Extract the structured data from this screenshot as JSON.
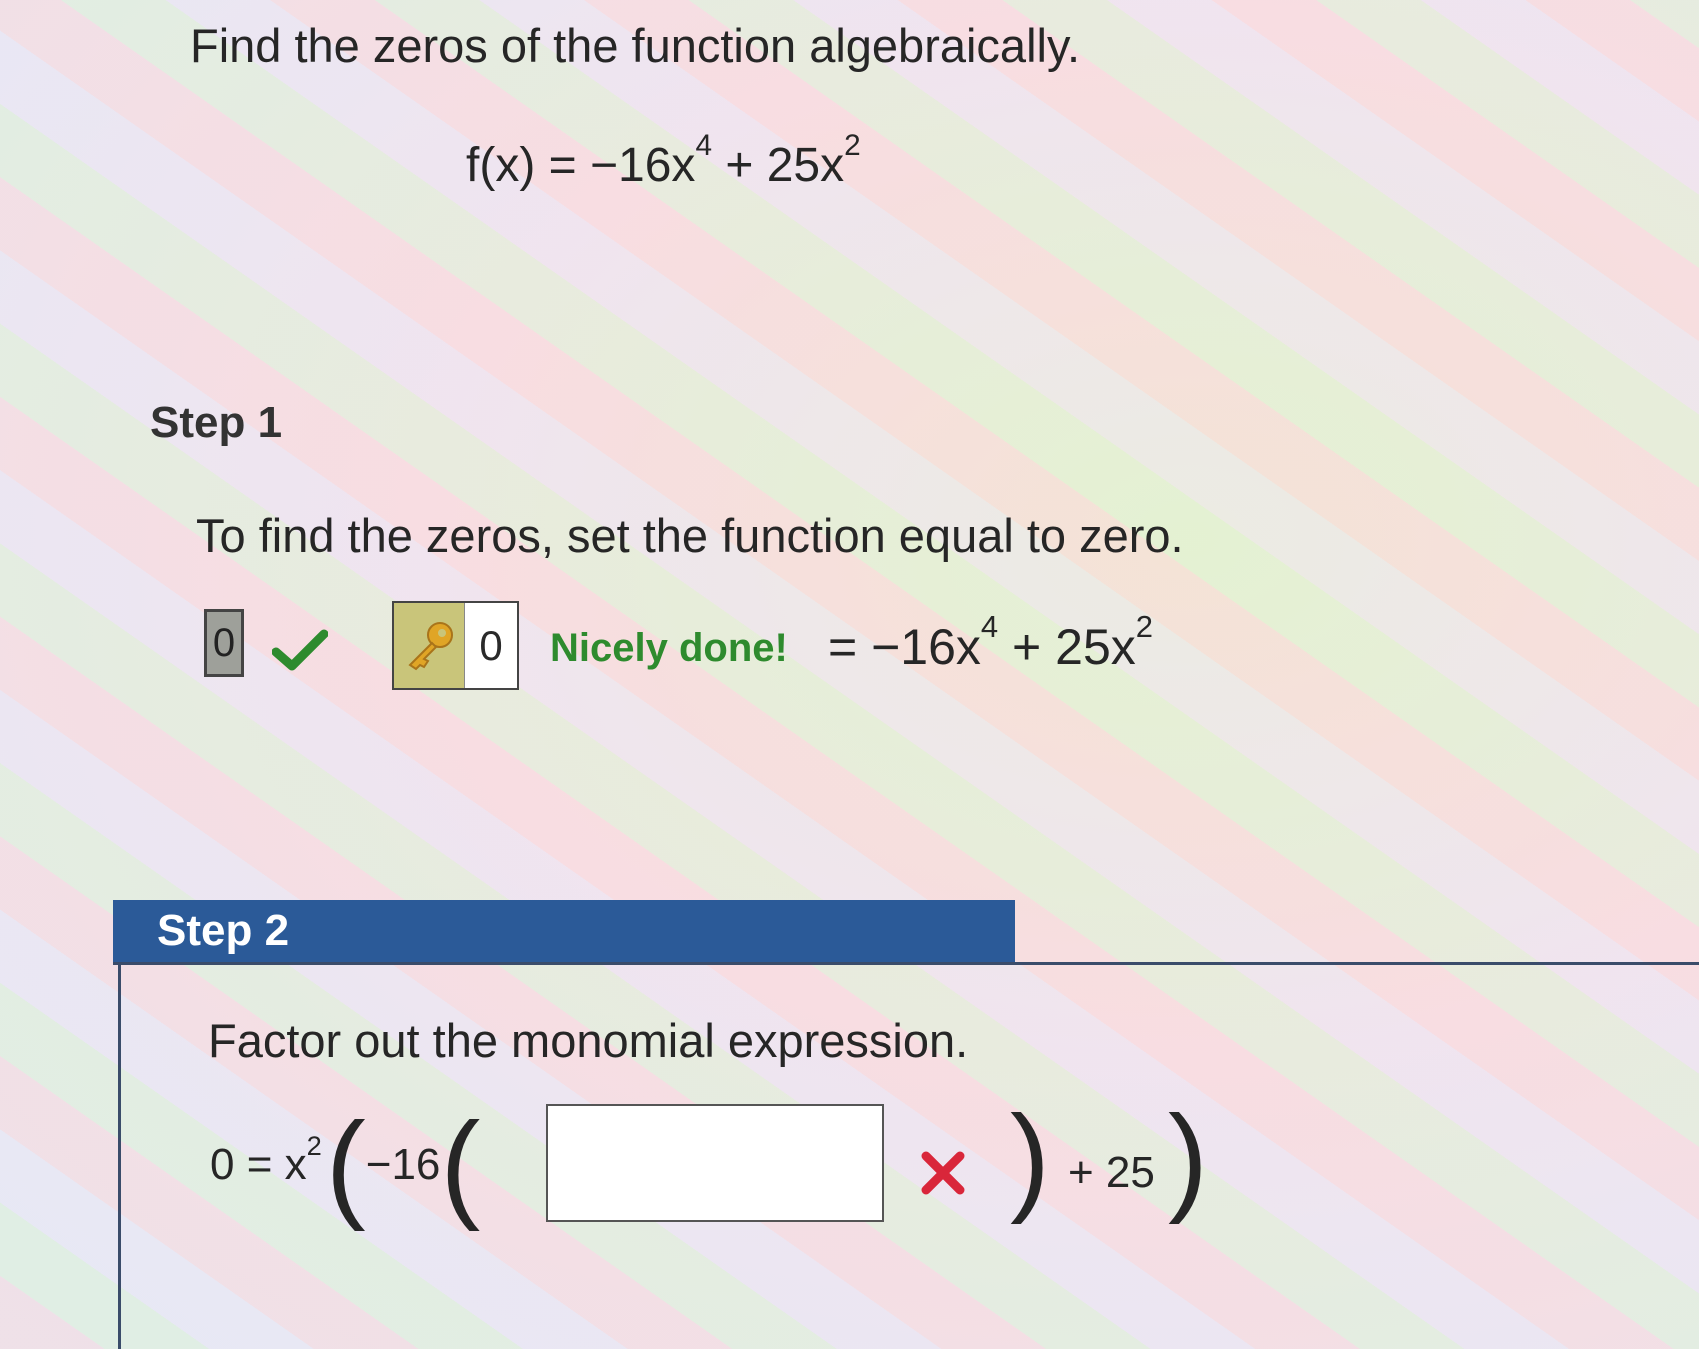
{
  "problem": {
    "title": "Find the zeros of the function algebraically.",
    "function_lhs": "f(x) = −16x",
    "exp4": "4",
    "function_mid": " + 25x",
    "exp2": "2"
  },
  "step1": {
    "title": "Step 1",
    "instruction": "To find the zeros, set the function equal to zero.",
    "answer_value": "0",
    "key_value": "0",
    "feedback": "Nicely done!",
    "rhs_lhs": "= −16x",
    "rhs_exp4": "4",
    "rhs_mid": " + 25x",
    "rhs_exp2": "2"
  },
  "step2": {
    "title": "Step 2",
    "instruction": "Factor out the monomial expression.",
    "eq_start": "0 = x",
    "eq_exp": "2",
    "eq_coef": "−16",
    "input_value": "",
    "eq_tail": "+ 25"
  },
  "colors": {
    "header_blue": "#2b5a98",
    "correct_green": "#2e8b2e",
    "incorrect_red": "#d9263a"
  }
}
